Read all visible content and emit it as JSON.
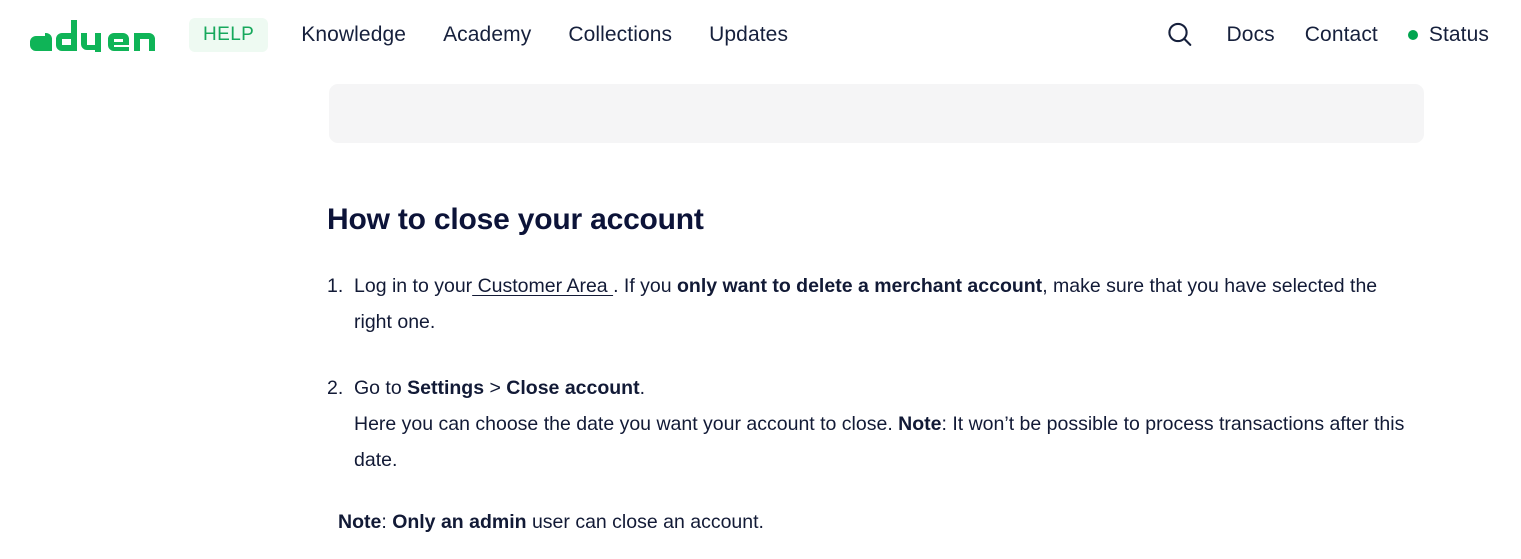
{
  "header": {
    "logo_text": "adyen",
    "logo_color": "#0fb457",
    "help_badge": "HELP",
    "nav_primary": [
      {
        "label": "Knowledge"
      },
      {
        "label": "Academy"
      },
      {
        "label": "Collections"
      },
      {
        "label": "Updates"
      }
    ],
    "search_icon": "search-icon",
    "nav_secondary": [
      {
        "label": "Docs"
      },
      {
        "label": "Contact"
      }
    ],
    "status": {
      "label": "Status",
      "dot_color": "#01a54f"
    }
  },
  "main": {
    "title": "How to close your account",
    "steps": [
      {
        "number": "1.",
        "text_before_link": "Log in to your",
        "link_text": " Customer Area ",
        "text_after_link": ". If you ",
        "bold_1": "only want to delete a merchant account",
        "text_tail": ", make sure that you have selected the right one."
      },
      {
        "number": "2.",
        "text_lead": "Go to ",
        "bold_1": "Settings",
        "text_mid": " > ",
        "bold_2": "Close account",
        "text_end": ".",
        "sub_text_1": "Here you can choose the date you want your account to close. ",
        "sub_bold": "Note",
        "sub_text_2": ": It won’t be possible to process transactions after this date."
      }
    ],
    "note": {
      "label": "Note",
      "separator": ": ",
      "bold_text": "Only an admin",
      "rest_text": " user can close an account."
    }
  }
}
